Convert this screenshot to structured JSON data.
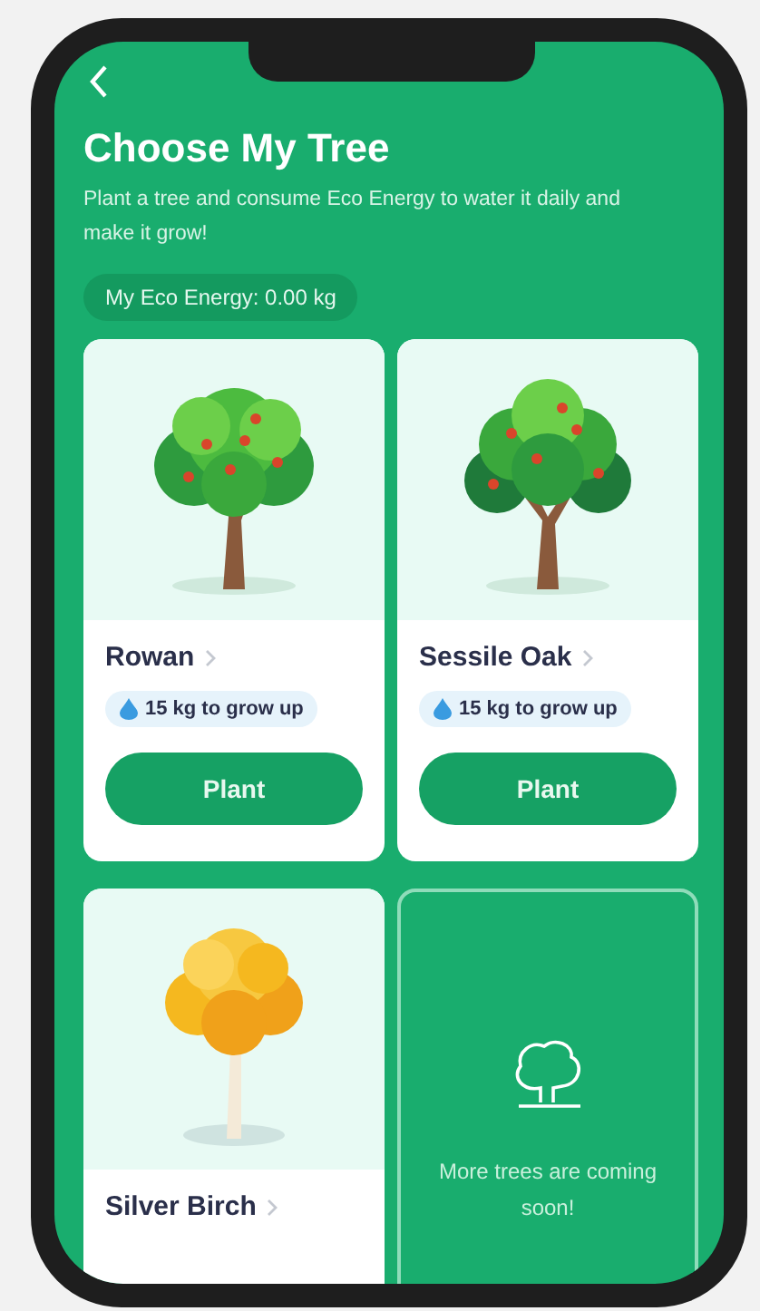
{
  "header": {
    "title": "Choose My Tree",
    "subtitle": "Plant a tree and consume Eco Energy to water it daily and make it grow!",
    "energy": "My Eco Energy: 0.00 kg"
  },
  "cards": [
    {
      "kind": "tree",
      "image": {
        "kind": "rowan"
      },
      "name": "Rowan",
      "requirement": "15 kg to grow up",
      "button": "Plant"
    },
    {
      "kind": "tree",
      "image": {
        "kind": "oak"
      },
      "name": "Sessile Oak",
      "requirement": "15 kg to grow up",
      "button": "Plant"
    },
    {
      "kind": "tree",
      "image": {
        "kind": "birch"
      },
      "name": "Silver Birch"
    },
    {
      "kind": "soon",
      "message": "More trees are coming soon!"
    }
  ]
}
